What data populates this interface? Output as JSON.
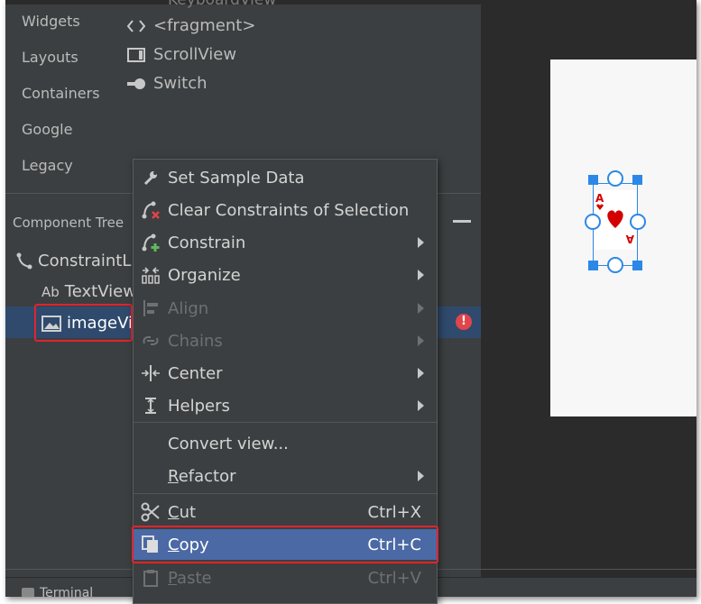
{
  "palette": {
    "top_partial": "KeyboardView",
    "categories": [
      "Widgets",
      "Layouts",
      "Containers",
      "Google",
      "Legacy"
    ],
    "items": [
      {
        "label": "<fragment>",
        "icon": "code-brackets-icon"
      },
      {
        "label": "ScrollView",
        "icon": "scrollview-icon"
      },
      {
        "label": "Switch",
        "icon": "switch-toggle-icon"
      }
    ]
  },
  "component_tree": {
    "title": "Component Tree",
    "root": "ConstraintL",
    "children": [
      {
        "label": "TextView",
        "prefix": "Ab"
      },
      {
        "label": "imageVi",
        "selected": true,
        "error": "!"
      }
    ]
  },
  "context_menu": {
    "items": [
      {
        "label": "Set Sample Data",
        "icon": "wrench-icon"
      },
      {
        "label": "Clear Constraints of Selection",
        "icon": "clear-constraints-icon"
      },
      {
        "label": "Constrain",
        "icon": "constrain-icon",
        "submenu": true
      },
      {
        "label": "Organize",
        "icon": "organize-icon",
        "submenu": true
      },
      {
        "label": "Align",
        "icon": "align-icon",
        "submenu": true,
        "disabled": true
      },
      {
        "label": "Chains",
        "icon": "chains-icon",
        "submenu": true,
        "disabled": true
      },
      {
        "label": "Center",
        "icon": "center-icon",
        "submenu": true
      },
      {
        "label": "Helpers",
        "icon": "helpers-icon",
        "submenu": true
      },
      {
        "label": "Convert view...",
        "icon": ""
      },
      {
        "label": "Refactor",
        "mnemonic": "R",
        "rest": "efactor",
        "submenu": true
      },
      {
        "label": "Cut",
        "mnemonic": "C",
        "rest": "ut",
        "shortcut": "Ctrl+X",
        "icon": "scissors-icon"
      },
      {
        "label": "Copy",
        "mnemonic": "C",
        "rest": "opy",
        "shortcut": "Ctrl+C",
        "icon": "copy-icon",
        "highlighted": true
      },
      {
        "label": "Paste",
        "mnemonic": "P",
        "rest": "aste",
        "shortcut": "Ctrl+V",
        "icon": "paste-icon",
        "disabled": true
      }
    ]
  },
  "bottom_bar": {
    "terminal": "Terminal"
  },
  "colors": {
    "selection": "#2f4a6d",
    "menu_highlight": "#4a69a5",
    "annotation_red": "#e0242c",
    "blueprint_blue": "#2c88e6"
  }
}
